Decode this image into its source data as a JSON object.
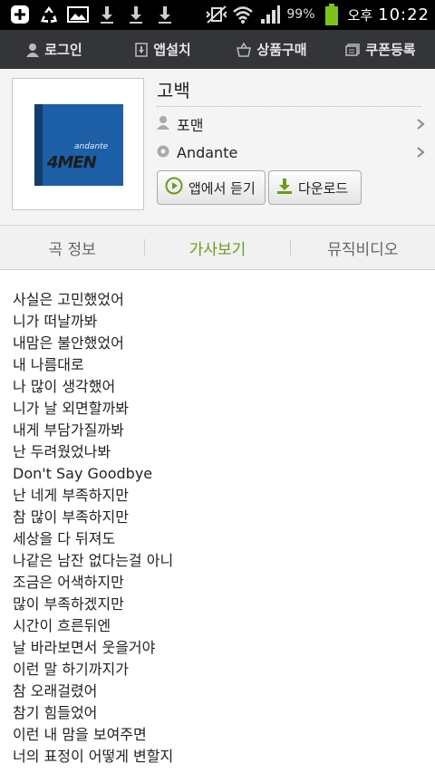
{
  "status_bar": {
    "battery": "99%",
    "ampm": "오후",
    "time": "10:22"
  },
  "top_nav": [
    {
      "label": "로그인",
      "icon": "person-icon"
    },
    {
      "label": "앱설치",
      "icon": "download-box-icon"
    },
    {
      "label": "상품구매",
      "icon": "basket-icon"
    },
    {
      "label": "쿠폰등록",
      "icon": "coupon-icon"
    }
  ],
  "album": {
    "title": "고백",
    "artist": "포맨",
    "album_name": "Andante",
    "cover_text": "4MEN",
    "cover_sign": "andante",
    "listen_button": "앱에서 듣기",
    "download_button": "다운로드",
    "accent_color": "#6b9c1c"
  },
  "tabs": [
    {
      "label": "곡 정보",
      "active": false
    },
    {
      "label": "가사보기",
      "active": true
    },
    {
      "label": "뮤직비디오",
      "active": false
    }
  ],
  "lyrics": [
    "사실은 고민했었어",
    "니가 떠날까봐",
    "내맘은 불안했었어",
    "내 나름대로",
    "나 많이 생각했어",
    "니가 날 외면할까봐",
    "내게 부담가질까봐",
    "난 두려웠었나봐",
    "Don't Say Goodbye",
    "난 네게 부족하지만",
    "참 많이 부족하지만",
    "세상을 다 뒤져도",
    "나같은 남잔 없다는걸 아니",
    "조금은 어색하지만",
    "많이 부족하겠지만",
    "시간이 흐른뒤엔",
    "날 바라보면서 웃을거야",
    "이런 말 하기까지가",
    "참 오래걸렸어",
    "참기 힘들었어",
    "이런 내 맘을 보여주면",
    "너의 표정이 어떻게 변할지"
  ]
}
